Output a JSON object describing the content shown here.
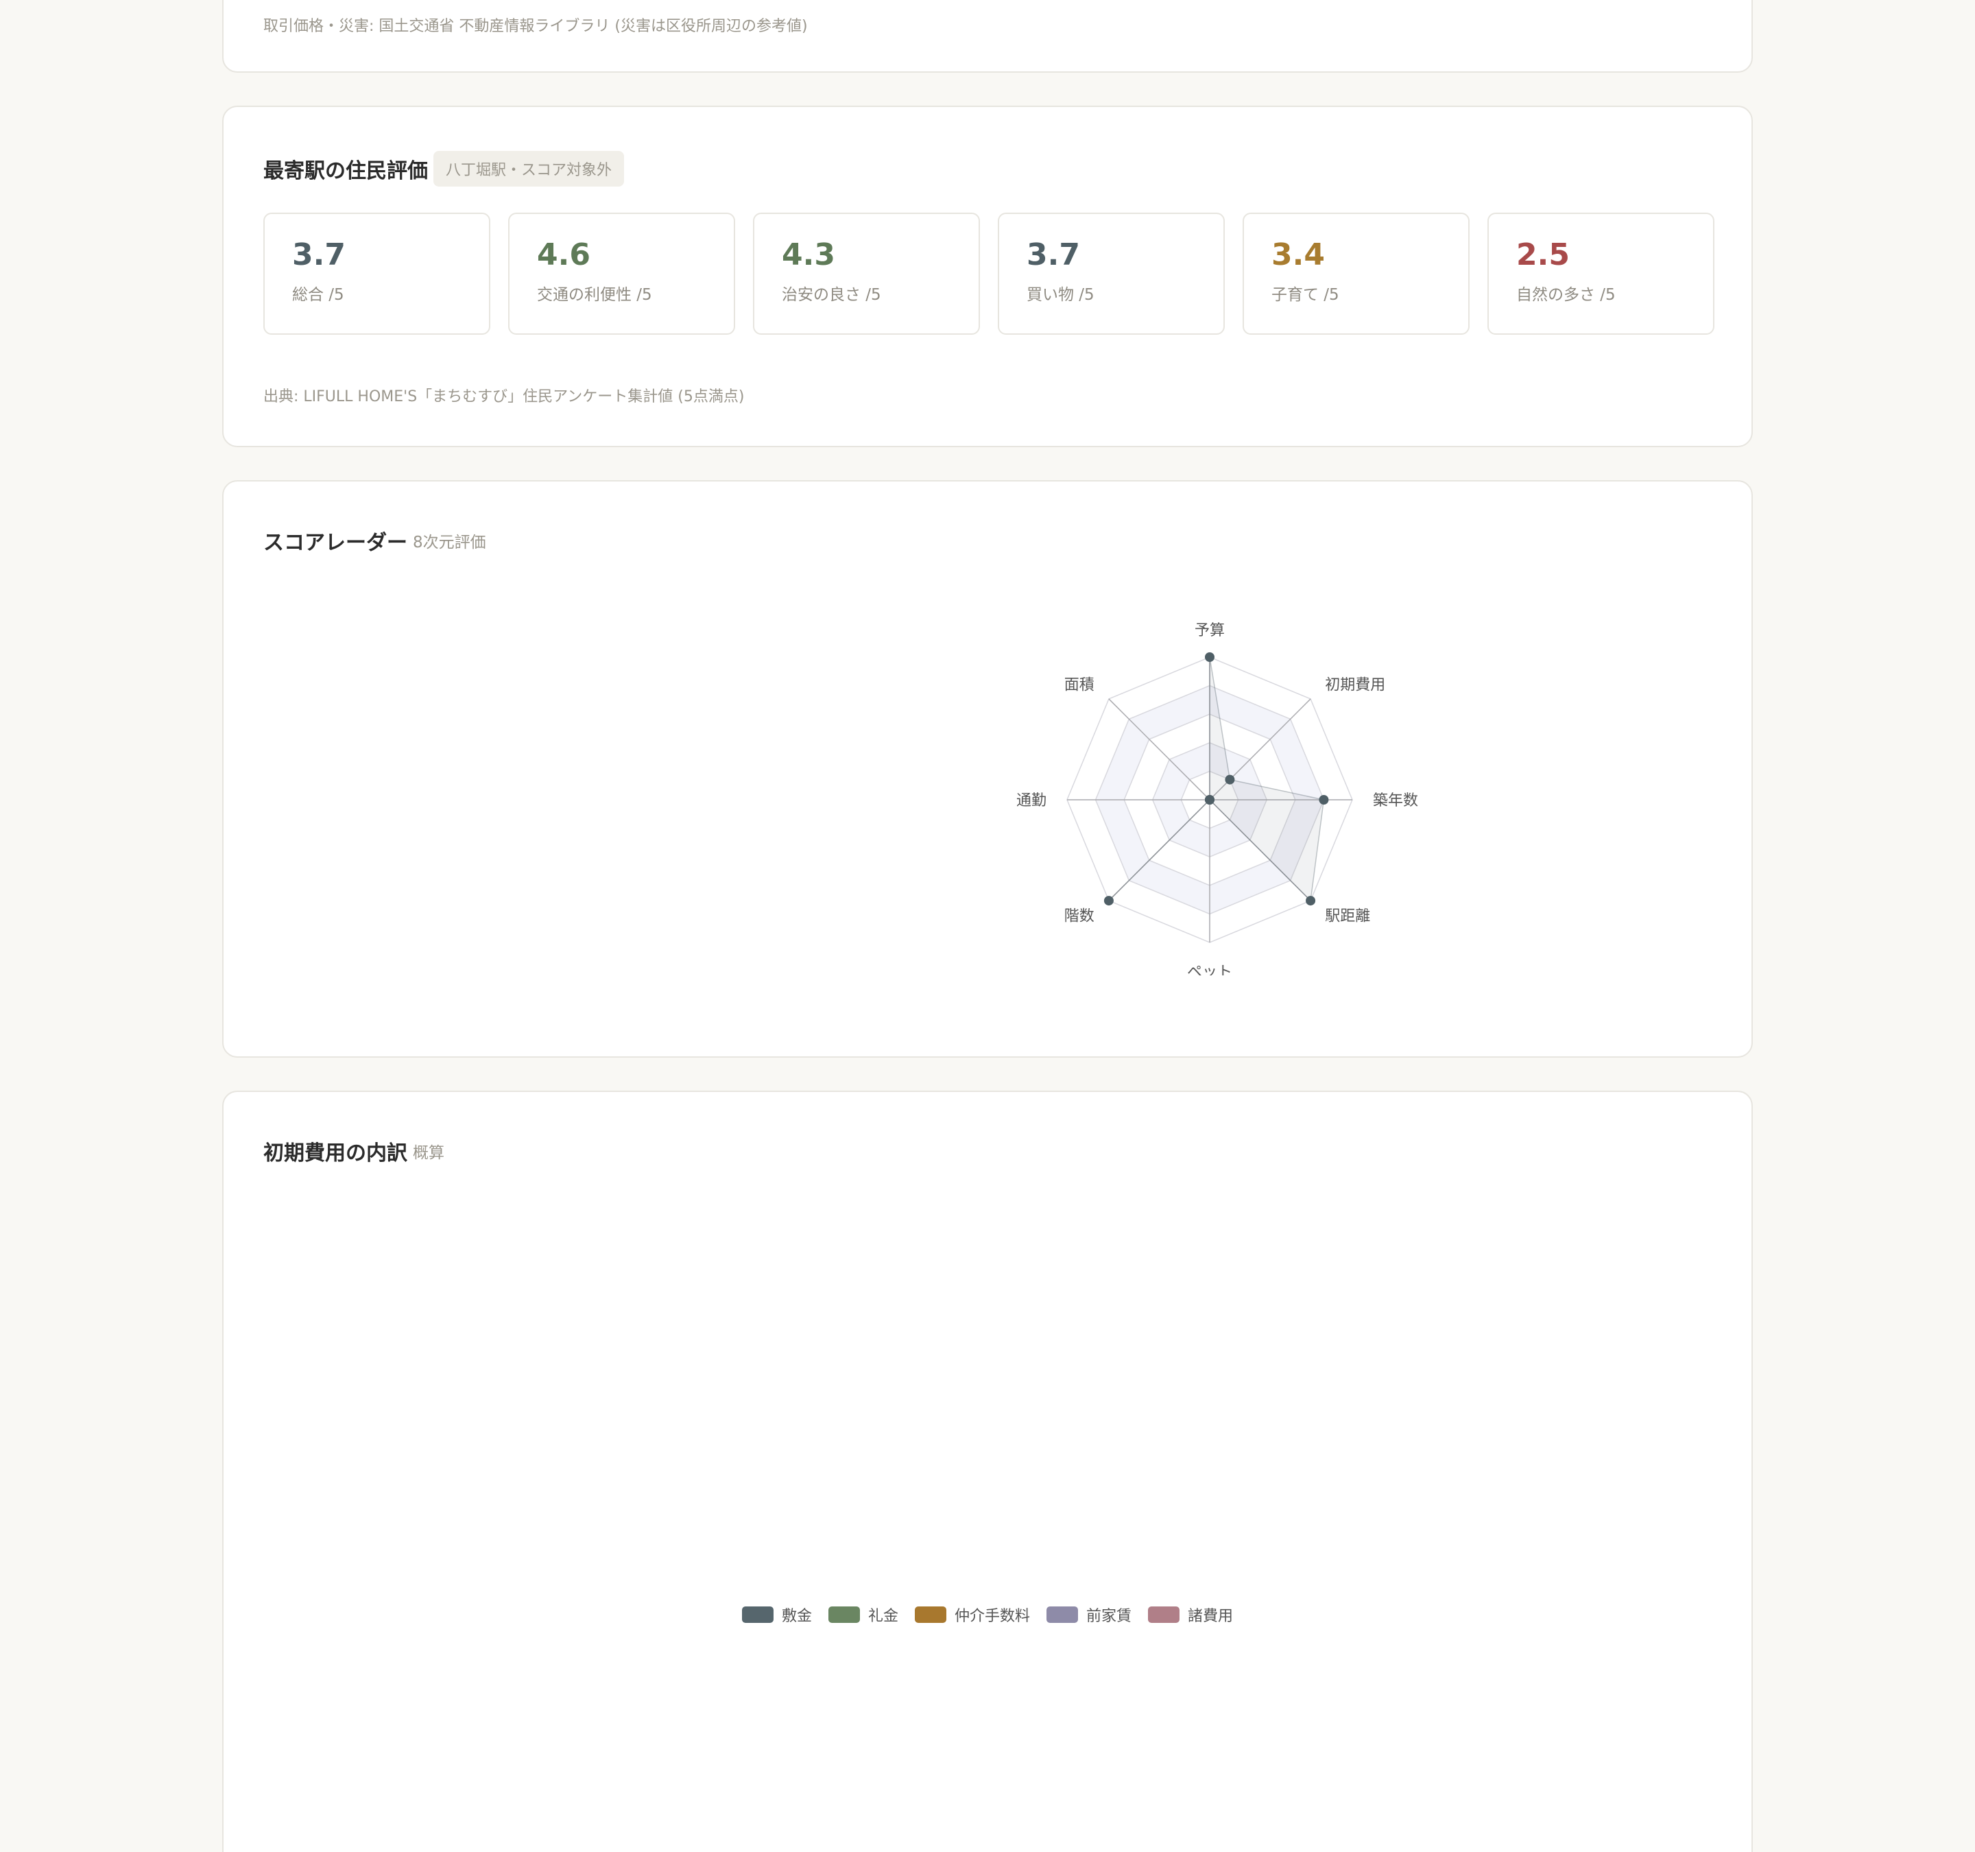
{
  "source_card": {
    "note": "取引価格・災害: 国土交通省 不動産情報ライブラリ (災害は区役所周辺の参考値)"
  },
  "rating_card": {
    "title": "最寄駅の住民評価",
    "badge": "八丁堀駅・スコア対象外",
    "items": [
      {
        "value": "3.7",
        "label": "総合 /5",
        "color": "#4f5f66"
      },
      {
        "value": "4.6",
        "label": "交通の利便性 /5",
        "color": "#5e7a57"
      },
      {
        "value": "4.3",
        "label": "治安の良さ /5",
        "color": "#5e7a57"
      },
      {
        "value": "3.7",
        "label": "買い物 /5",
        "color": "#4f5f66"
      },
      {
        "value": "3.4",
        "label": "子育て /5",
        "color": "#a87c2f"
      },
      {
        "value": "2.5",
        "label": "自然の多さ /5",
        "color": "#a84a4a"
      }
    ],
    "source": "出典: LIFULL HOME'S「まちむすび」住民アンケート集計値 (5点満点)"
  },
  "radar_card": {
    "title": "スコアレーダー",
    "subtitle": "8次元評価",
    "chart_data": {
      "type": "radar",
      "axes": [
        "予算",
        "初期費用",
        "築年数",
        "駅距離",
        "ペット",
        "階数",
        "通勤",
        "面積"
      ],
      "values": [
        100,
        20,
        80,
        100,
        0,
        100,
        0,
        0
      ],
      "rmax": 100,
      "rings": 5,
      "point_color": "#4f5f66",
      "ring_fill": "#f3f4fa",
      "grid_color": "#d8d8de"
    }
  },
  "cost_card": {
    "title": "初期費用の内訳",
    "subtitle": "概算",
    "legend": [
      {
        "label": "敷金",
        "color": "#56666d"
      },
      {
        "label": "礼金",
        "color": "#6a8662"
      },
      {
        "label": "仲介手数料",
        "color": "#a8782e"
      },
      {
        "label": "前家賃",
        "color": "#8e8ba8"
      },
      {
        "label": "諸費用",
        "color": "#b07f88"
      }
    ]
  }
}
